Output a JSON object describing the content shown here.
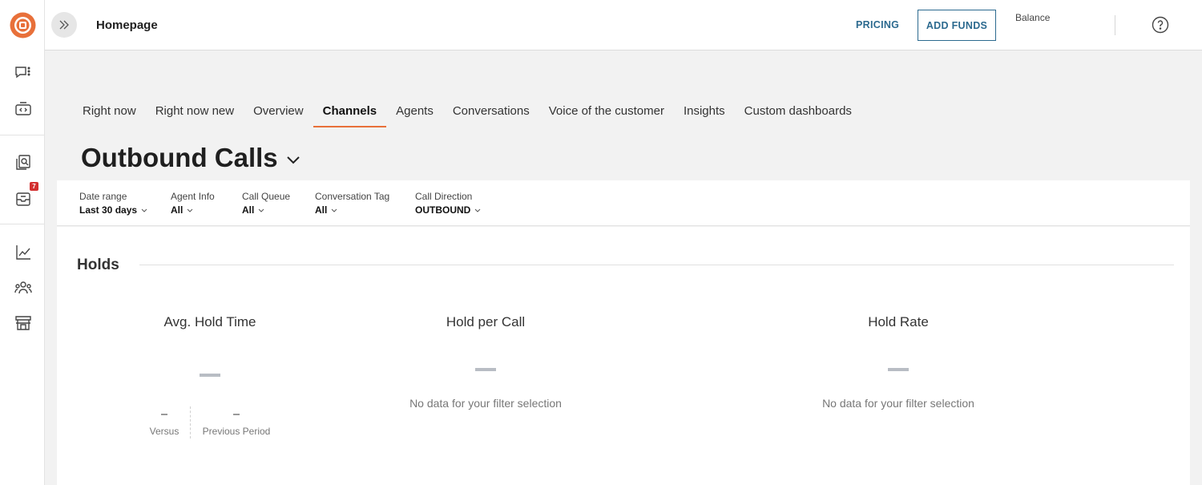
{
  "topbar": {
    "page_title": "Homepage",
    "pricing_label": "PRICING",
    "add_funds_label": "ADD FUNDS",
    "balance_label": "Balance"
  },
  "rail": {
    "badge_count": "7",
    "icons": [
      "logo-icon",
      "chat-list-icon",
      "code-box-icon",
      "review-icon",
      "inbox-icon",
      "chart-icon",
      "team-icon",
      "store-icon"
    ]
  },
  "tabs": [
    {
      "label": "Right now",
      "active": false
    },
    {
      "label": "Right now new",
      "active": false
    },
    {
      "label": "Overview",
      "active": false
    },
    {
      "label": "Channels",
      "active": true
    },
    {
      "label": "Agents",
      "active": false
    },
    {
      "label": "Conversations",
      "active": false
    },
    {
      "label": "Voice of the customer",
      "active": false
    },
    {
      "label": "Insights",
      "active": false
    },
    {
      "label": "Custom dashboards",
      "active": false
    }
  ],
  "heading": "Outbound Calls",
  "filters": {
    "date_range": {
      "label": "Date range",
      "value": "Last 30 days"
    },
    "agent_info": {
      "label": "Agent Info",
      "value": "All"
    },
    "call_queue": {
      "label": "Call Queue",
      "value": "All"
    },
    "conversation_tag": {
      "label": "Conversation Tag",
      "value": "All"
    },
    "call_direction": {
      "label": "Call Direction",
      "value": "OUTBOUND"
    }
  },
  "section": {
    "title": "Holds",
    "metrics": {
      "avg_hold_time": {
        "title": "Avg. Hold Time",
        "versus_value": "–",
        "versus_label": "Versus",
        "previous_value": "–",
        "previous_label": "Previous Period"
      },
      "hold_per_call": {
        "title": "Hold per Call",
        "empty_text": "No data for your filter selection"
      },
      "hold_rate": {
        "title": "Hold Rate",
        "empty_text": "No data for your filter selection"
      }
    }
  },
  "colors": {
    "accent": "#e8703a",
    "link": "#2c6a8f",
    "badge": "#d32f2f"
  }
}
